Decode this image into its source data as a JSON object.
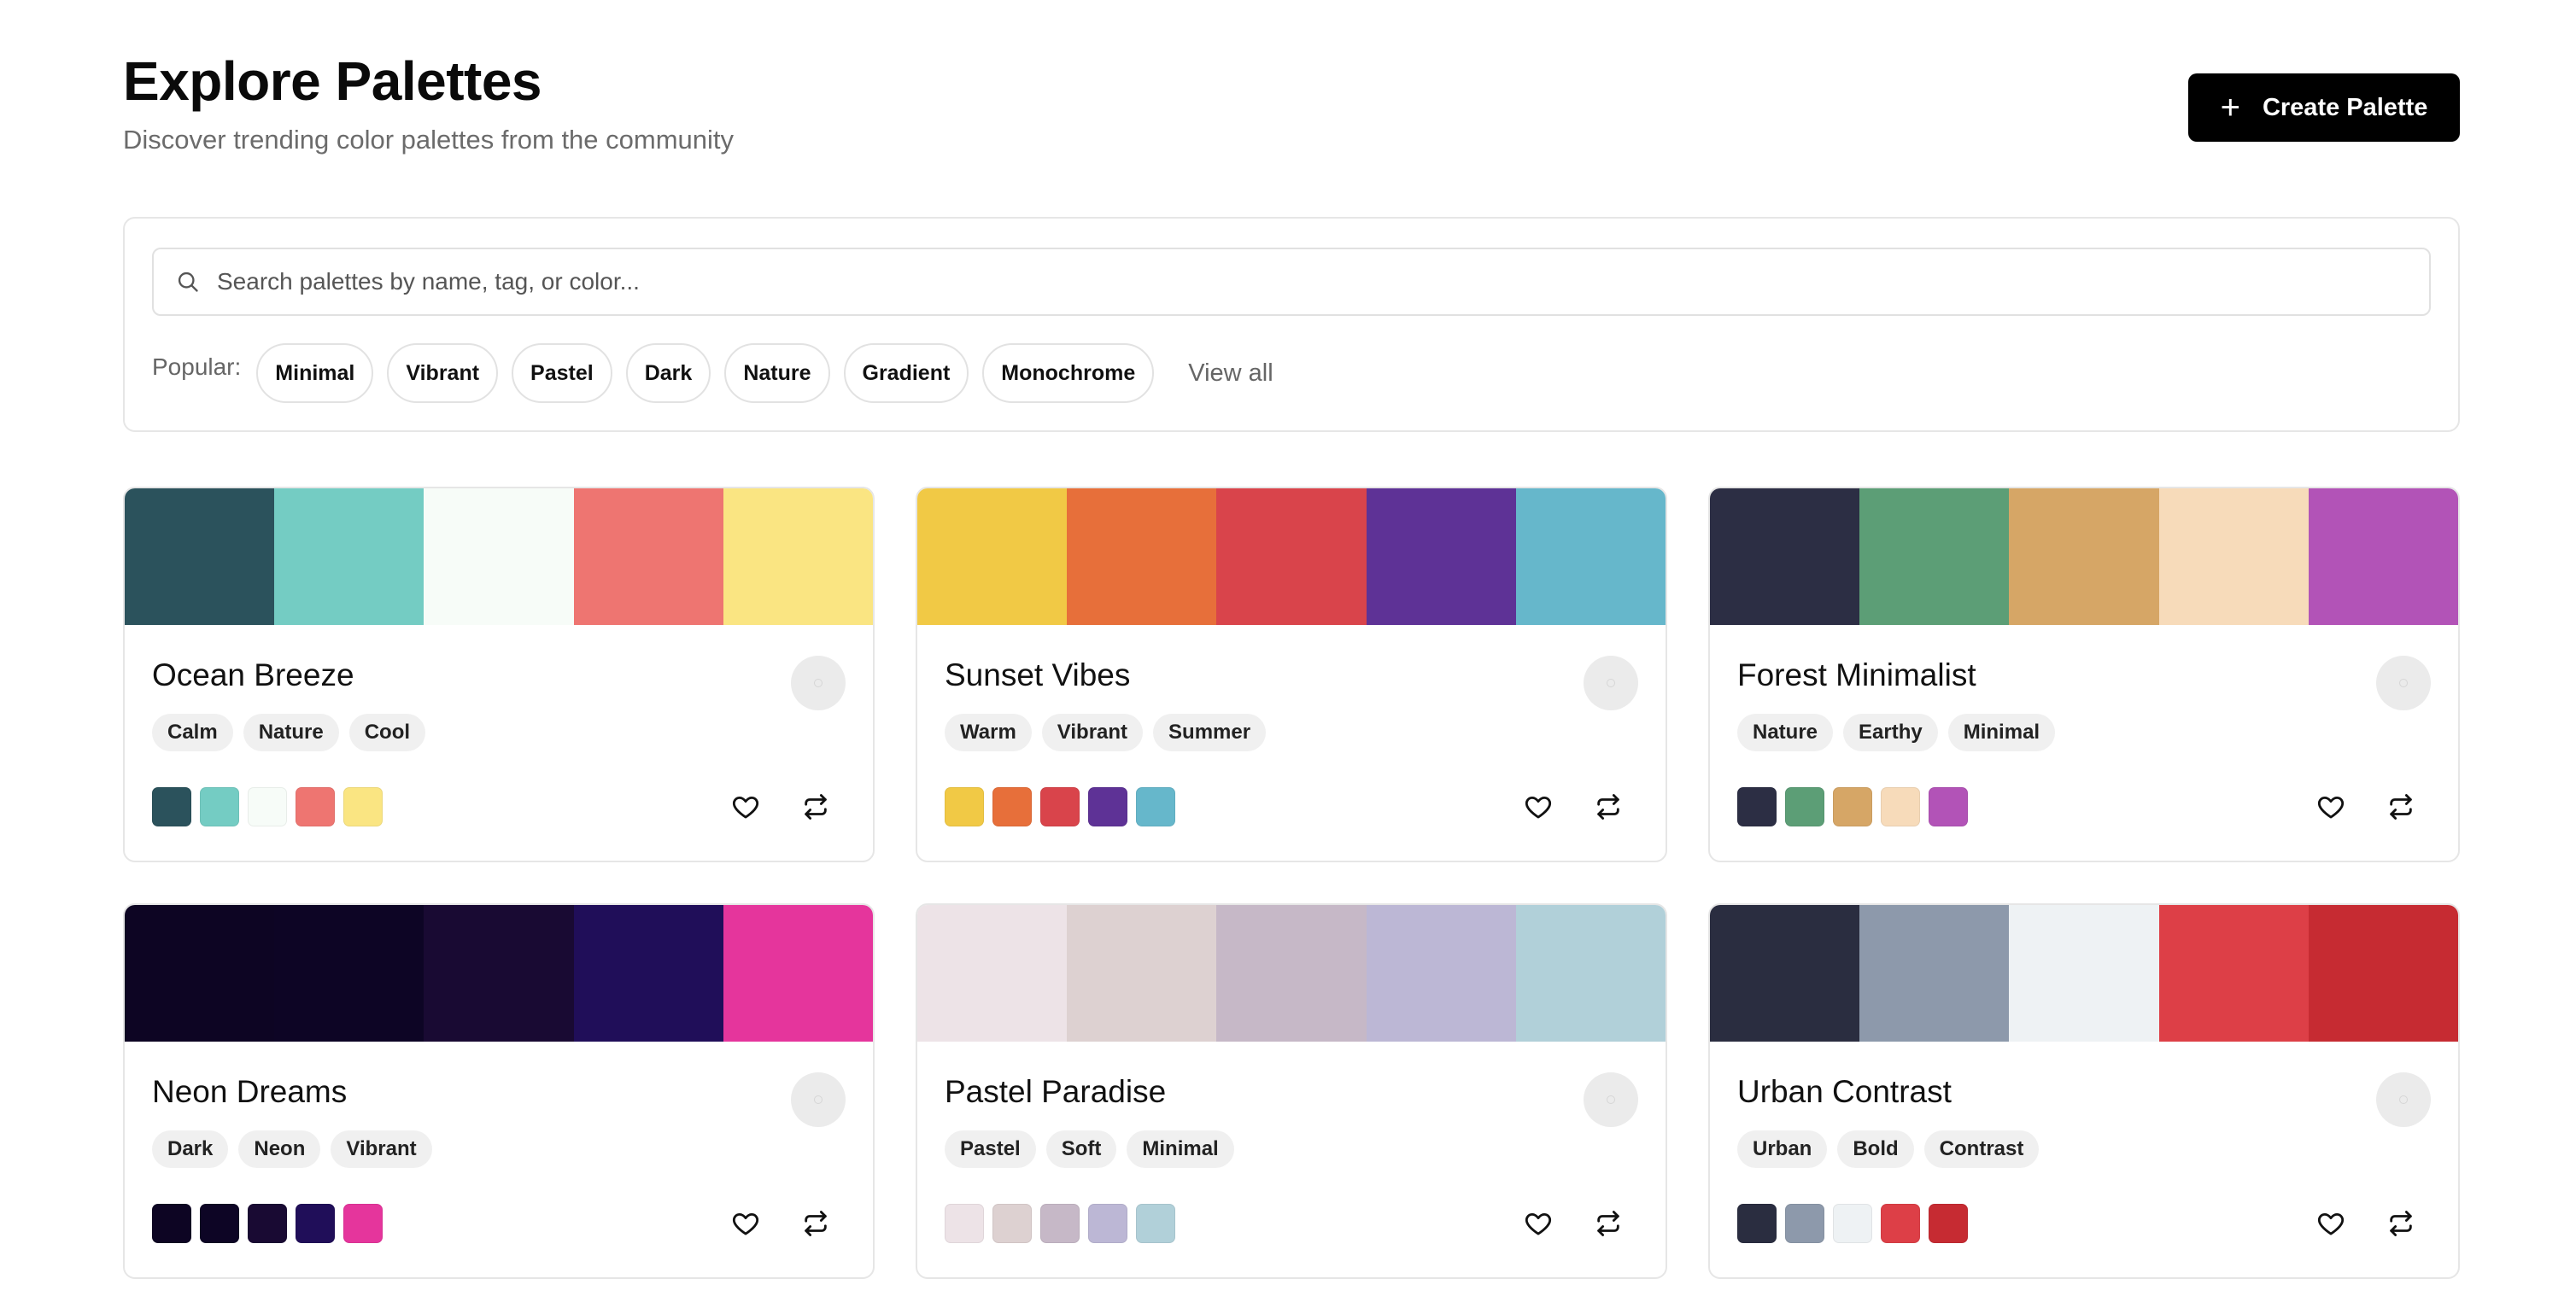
{
  "header": {
    "title": "Explore Palettes",
    "subtitle": "Discover trending color palettes from the community",
    "create_button": "Create Palette"
  },
  "search": {
    "placeholder": "Search palettes by name, tag, or color...",
    "popular_label": "Popular:",
    "chips": [
      "Minimal",
      "Vibrant",
      "Pastel",
      "Dark",
      "Nature",
      "Gradient",
      "Monochrome"
    ],
    "view_all": "View all"
  },
  "palettes": [
    {
      "name": "Ocean Breeze",
      "tags": [
        "Calm",
        "Nature",
        "Cool"
      ],
      "colors": [
        "#2b525c",
        "#74ccc3",
        "#f7fcf8",
        "#ee7571",
        "#fae582"
      ]
    },
    {
      "name": "Sunset Vibes",
      "tags": [
        "Warm",
        "Vibrant",
        "Summer"
      ],
      "colors": [
        "#f1c945",
        "#e76f3a",
        "#d9444b",
        "#5e3296",
        "#66b7cb"
      ]
    },
    {
      "name": "Forest Minimalist",
      "tags": [
        "Nature",
        "Earthy",
        "Minimal"
      ],
      "colors": [
        "#2c2e44",
        "#5c9e76",
        "#d6a666",
        "#f7dbba",
        "#b253b7"
      ]
    },
    {
      "name": "Neon Dreams",
      "tags": [
        "Dark",
        "Neon",
        "Vibrant"
      ],
      "colors": [
        "#0d0523",
        "#0d0525",
        "#190a33",
        "#200e59",
        "#e5359c"
      ]
    },
    {
      "name": "Pastel Paradise",
      "tags": [
        "Pastel",
        "Soft",
        "Minimal"
      ],
      "colors": [
        "#ede3e7",
        "#ddd1d1",
        "#c6b8c7",
        "#bcb7d5",
        "#b1d0d9"
      ]
    },
    {
      "name": "Urban Contrast",
      "tags": [
        "Urban",
        "Bold",
        "Contrast"
      ],
      "colors": [
        "#2a2d40",
        "#8d99ab",
        "#eef2f4",
        "#dd3f47",
        "#c62b32"
      ]
    }
  ]
}
